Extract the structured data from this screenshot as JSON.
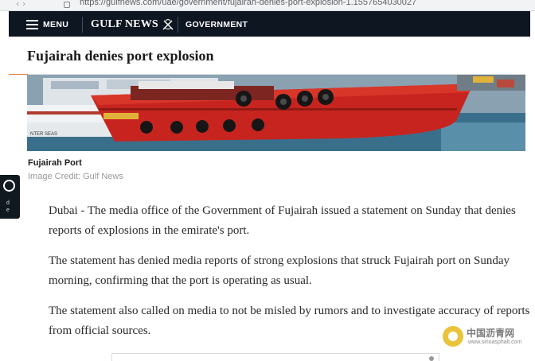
{
  "browser": {
    "url": "https://gulfnews.com/uae/government/fujairah-denies-port-explosion-1.1557654030027"
  },
  "header": {
    "menu_label": "MENU",
    "logo_text": "GULF NEWS",
    "section_label": "GOVERNMENT",
    "background_color": "#0d1621"
  },
  "article": {
    "headline": "Fujairah denies port explosion",
    "image_caption": "Fujairah Port",
    "image_credit": "Image Credit: Gulf News",
    "paragraphs": [
      "Dubai - The media office of the Government of Fujairah issued a statement on Sunday that denies reports of explosions in the emirate's port.",
      "The statement has denied media reports of strong explosions that struck Fujairah port on Sunday morning, confirming that the port is operating as usual.",
      "The statement also called on media to not be misled by rumors and to investigate accuracy of reports from official sources."
    ]
  },
  "watermark": {
    "name": "中国沥青网",
    "url": "www.sinoasphalt.com"
  },
  "colors": {
    "accent": "#e07f3c",
    "ship_red": "#c8241f",
    "water": "#3a6f8c"
  }
}
